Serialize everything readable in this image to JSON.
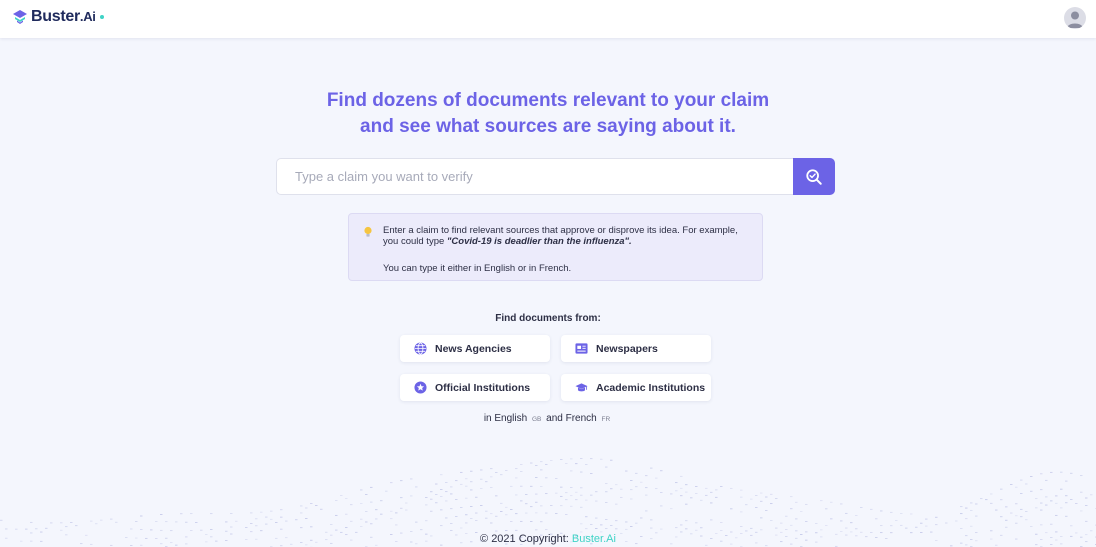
{
  "header": {
    "logo_text": "Buster",
    "logo_suffix": "Ai",
    "colors": {
      "brand": "#1f2a5c",
      "accent": "#6c63e6",
      "teal": "#3fd3c6"
    }
  },
  "hero": {
    "headline_line1": "Find dozens of documents relevant to your claim",
    "headline_line2": "and see what sources are saying about it."
  },
  "search": {
    "placeholder": "Type a claim you want to verify",
    "value": "",
    "button_icon": "search-check-icon"
  },
  "hint": {
    "icon": "lightbulb-icon",
    "text_prefix": "Enter a claim to find relevant sources that approve or disprove its idea. For example, you could type ",
    "example": "\"Covid-19 is deadlier than the influenza\".",
    "languages_note": "You can type it either in English or in French."
  },
  "sources": {
    "title": "Find documents from:",
    "items": [
      {
        "label": "News Agencies",
        "icon": "globe-icon"
      },
      {
        "label": "Newspapers",
        "icon": "newspaper-icon"
      },
      {
        "label": "Official Institutions",
        "icon": "badge-icon"
      },
      {
        "label": "Academic Institutions",
        "icon": "graduation-cap-icon"
      }
    ]
  },
  "languages": {
    "prefix": "in English",
    "en_code": "GB",
    "middle": "and French",
    "fr_code": "FR"
  },
  "footer": {
    "copyright": "© 2021 Copyright:",
    "brand": "Buster.Ai"
  }
}
